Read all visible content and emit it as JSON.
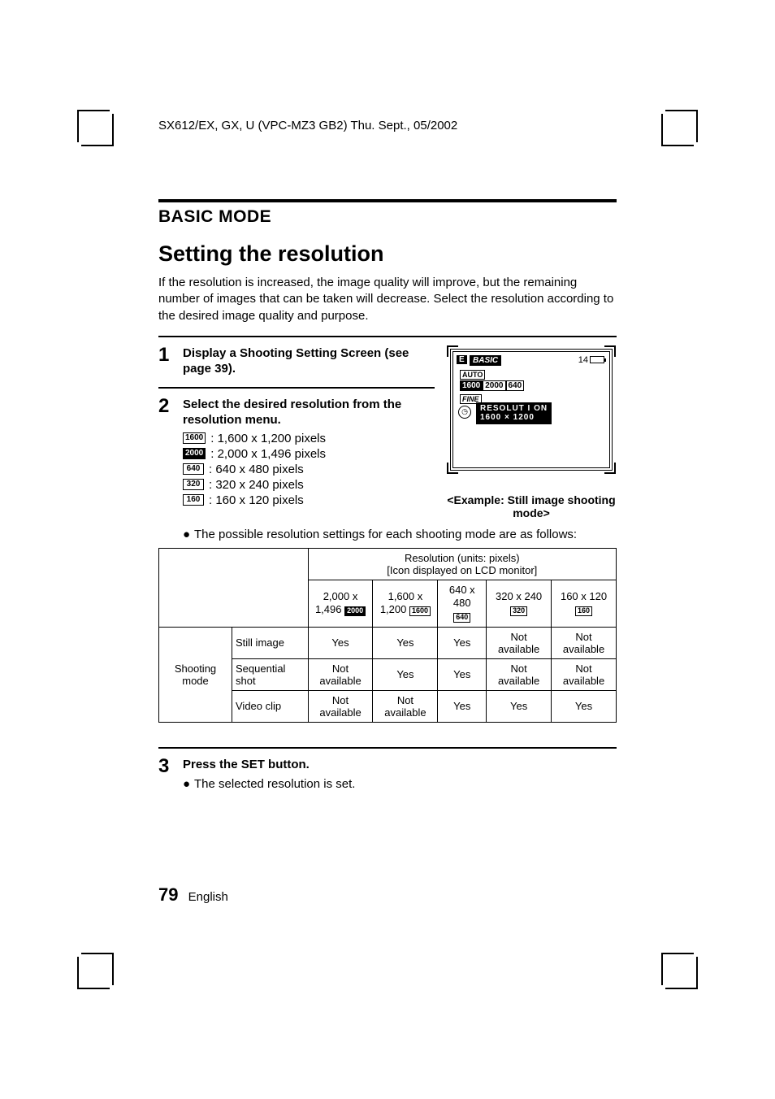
{
  "header": "SX612/EX, GX, U (VPC-MZ3 GB2)    Thu. Sept., 05/2002",
  "section": "BASIC MODE",
  "title": "Setting the resolution",
  "intro": "If the resolution is increased, the image quality will improve, but the remaining number of images that can be taken will decrease. Select the resolution according to the desired image quality and purpose.",
  "steps": {
    "s1": {
      "num": "1",
      "title": "Display a Shooting Setting Screen (see page 39)."
    },
    "s2": {
      "num": "2",
      "title": "Select the desired resolution from the resolution menu.",
      "opts": {
        "a": {
          "icon": "1600",
          "inv": false,
          "text": ": 1,600 x 1,200 pixels"
        },
        "b": {
          "icon": "2000",
          "inv": true,
          "text": ": 2,000 x 1,496 pixels"
        },
        "c": {
          "icon": "640",
          "inv": false,
          "text": ": 640 x 480 pixels"
        },
        "d": {
          "icon": "320",
          "inv": false,
          "text": ": 320 x 240 pixels"
        },
        "e": {
          "icon": "160",
          "inv": false,
          "text": ": 160 x 120 pixels"
        }
      },
      "bullet": "The possible resolution settings for each shooting mode are as follows:"
    },
    "s3": {
      "num": "3",
      "title": "Press the SET button.",
      "bullet": "The selected resolution is set."
    }
  },
  "lcd": {
    "e": "E",
    "basic": "BASIC",
    "count": "14",
    "auto": "AUTO",
    "r1": "1600",
    "r2": "2000",
    "r3": "640",
    "fine": "FINE",
    "info1": "RESOLUT I ON",
    "info2": "1600 × 1200",
    "caption": "<Example: Still image shooting mode>"
  },
  "table": {
    "top": "Resolution (units: pixels)",
    "top2": "[Icon displayed on LCD monitor]",
    "cols": {
      "c1a": "2,000 x",
      "c1b": "1,496",
      "c1i": "2000",
      "c2a": "1,600 x",
      "c2b": "1,200",
      "c2i": "1600",
      "c3a": "640 x 480",
      "c3i": "640",
      "c4a": "320 x 240",
      "c4i": "320",
      "c5a": "160 x 120",
      "c5i": "160"
    },
    "rowhdr": "Shooting mode",
    "rows": {
      "r1": {
        "label": "Still image",
        "v": [
          "Yes",
          "Yes",
          "Yes",
          "Not available",
          "Not available"
        ]
      },
      "r2": {
        "label": "Sequential shot",
        "v": [
          "Not available",
          "Yes",
          "Yes",
          "Not available",
          "Not available"
        ]
      },
      "r3": {
        "label": "Video clip",
        "v": [
          "Not available",
          "Not available",
          "Yes",
          "Yes",
          "Yes"
        ]
      }
    }
  },
  "footer": {
    "page": "79",
    "lang": "English"
  }
}
